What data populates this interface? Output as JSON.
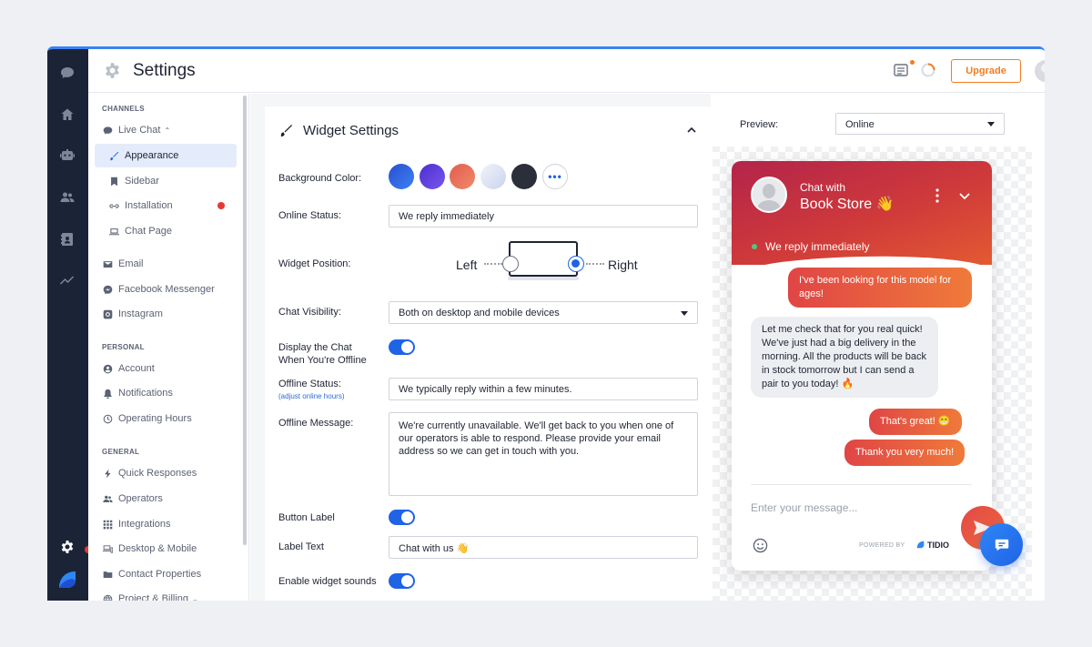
{
  "topbar": {
    "title": "Settings",
    "upgrade_label": "Upgrade"
  },
  "nav": {
    "sections": {
      "channels": "CHANNELS",
      "personal": "PERSONAL",
      "general": "GENERAL"
    },
    "live_chat": "Live Chat",
    "appearance": "Appearance",
    "sidebar": "Sidebar",
    "installation": "Installation",
    "chat_page": "Chat Page",
    "email": "Email",
    "facebook": "Facebook Messenger",
    "instagram": "Instagram",
    "account": "Account",
    "notifications": "Notifications",
    "operating_hours": "Operating Hours",
    "quick_responses": "Quick Responses",
    "operators": "Operators",
    "integrations": "Integrations",
    "desktop_mobile": "Desktop & Mobile",
    "contact_properties": "Contact Properties",
    "project_billing": "Project & Billing"
  },
  "widget_settings": {
    "title": "Widget Settings",
    "background_color_label": "Background Color:",
    "colors": [
      "#2f6fe0",
      "#5b3fd6",
      "#e86a5a",
      "#dde3f2",
      "#2a2f3a"
    ],
    "online_status_label": "Online Status:",
    "online_status_value": "We reply immediately",
    "widget_position_label": "Widget Position:",
    "position_left": "Left",
    "position_right": "Right",
    "position_selected": "Right",
    "chat_visibility_label": "Chat Visibility:",
    "chat_visibility_value": "Both on desktop and mobile devices",
    "display_offline_label_1": "Display the Chat",
    "display_offline_label_2": "When You're Offline",
    "display_offline_on": true,
    "offline_status_label": "Offline Status:",
    "offline_status_sub": "(adjust online hours)",
    "offline_status_value": "We typically reply within a few minutes.",
    "offline_message_label": "Offline Message:",
    "offline_message_value": "We're currently unavailable. We'll get back to you when one of our operators is able to respond. Please provide your email address so we can get in touch with you.",
    "button_label_label": "Button Label",
    "button_label_on": true,
    "label_text_label": "Label Text",
    "label_text_value": "Chat with us 👋",
    "widget_sounds_label": "Enable widget sounds",
    "widget_sounds_on": true
  },
  "preview": {
    "label": "Preview:",
    "select_value": "Online",
    "widget": {
      "chat_with": "Chat with",
      "name": "Book Store 👋",
      "status": "We reply immediately",
      "messages": [
        {
          "from": "visitor",
          "text": "I've been looking for this model for ages!"
        },
        {
          "from": "operator",
          "text": "Let me check that for you real quick! We've just had a big delivery in the morning. All the products will be back in stock tomorrow but I can send a pair to you today! 🔥"
        },
        {
          "from": "visitor",
          "text": "That's great! 😁"
        },
        {
          "from": "visitor",
          "text": "Thank you very much!"
        }
      ],
      "input_placeholder": "Enter your message...",
      "powered_by": "POWERED BY",
      "brand": "TIDIO"
    }
  }
}
